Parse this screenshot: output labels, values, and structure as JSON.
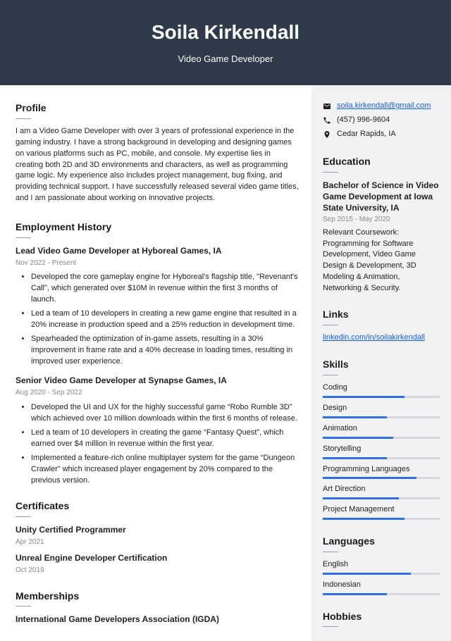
{
  "header": {
    "name": "Soila Kirkendall",
    "title": "Video Game Developer"
  },
  "profile": {
    "heading": "Profile",
    "text": "I am a Video Game Developer with over 3 years of professional experience in the gaming industry. I have a strong background in developing and designing games on various platforms such as PC, mobile, and console. My expertise lies in creating both 2D and 3D environments and characters, as well as programming game logic. My experience also includes project management, bug fixing, and providing technical support. I have successfully released several video game titles, and I am passionate about working on innovative projects."
  },
  "employment": {
    "heading": "Employment History",
    "jobs": [
      {
        "title": "Lead Video Game Developer at Hyboreal Games, IA",
        "dates": "Nov 2022 - Present",
        "bullets": [
          "Developed the core gameplay engine for Hyboreal's flagship title, \"Revenant's Call\", which generated over $10M in revenue within the first 3 months of launch.",
          "Led a team of 10 developers in creating a new game engine that resulted in a 20% increase in production speed and a 25% reduction in development time.",
          "Spearheaded the optimization of in-game assets, resulting in a 30% improvement in frame rate and a 40% decrease in loading times, resulting in improved user experience."
        ]
      },
      {
        "title": "Senior Video Game Developer at Synapse Games, IA",
        "dates": "Aug 2020 - Sep 2022",
        "bullets": [
          "Developed the UI and UX for the highly successful game “Robo Rumble 3D” which achieved over 10 million downloads within the first 6 months of release.",
          "Led a team of 10 developers in creating the game “Fantasy Quest”, which earned over $4 million in revenue within the first year.",
          "Implemented a feature-rich online multiplayer system for the game “Dungeon Crawler” which increased player engagement by 20% compared to the previous version."
        ]
      }
    ]
  },
  "certificates": {
    "heading": "Certificates",
    "items": [
      {
        "title": "Unity Certified Programmer",
        "date": "Apr 2021"
      },
      {
        "title": "Unreal Engine Developer Certification",
        "date": "Oct 2019"
      }
    ]
  },
  "memberships": {
    "heading": "Memberships",
    "items": [
      {
        "title": "International Game Developers Association (IGDA)"
      }
    ]
  },
  "contact": {
    "email": "soila.kirkendall@gmail.com",
    "phone": "(457) 996-9604",
    "location": "Cedar Rapids, IA"
  },
  "education": {
    "heading": "Education",
    "degree": "Bachelor of Science in Video Game Development at Iowa State University, IA",
    "dates": "Sep 2015 - May 2020",
    "desc": "Relevant Coursework: Programming for Software Development, Video Game Design & Development, 3D Modeling & Animation, Networking & Security."
  },
  "links": {
    "heading": "Links",
    "items": [
      "linkedin.com/in/soilakirkendall"
    ]
  },
  "skills": {
    "heading": "Skills",
    "items": [
      {
        "name": "Coding",
        "level": 70
      },
      {
        "name": "Design",
        "level": 55
      },
      {
        "name": "Animation",
        "level": 60
      },
      {
        "name": "Storytelling",
        "level": 55
      },
      {
        "name": "Programming Languages",
        "level": 80
      },
      {
        "name": "Art Direction",
        "level": 65
      },
      {
        "name": "Project Management",
        "level": 70
      }
    ]
  },
  "languages": {
    "heading": "Languages",
    "items": [
      {
        "name": "English",
        "level": 75
      },
      {
        "name": "Indonesian",
        "level": 55
      }
    ]
  },
  "hobbies": {
    "heading": "Hobbies"
  }
}
